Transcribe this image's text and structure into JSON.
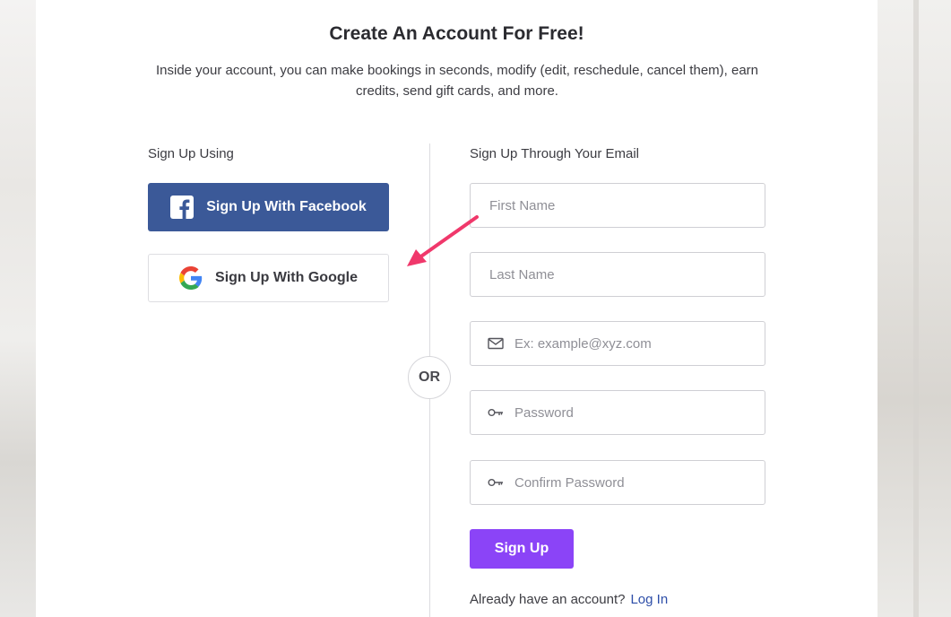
{
  "title": "Create An Account For Free!",
  "subtitle": "Inside your account, you can make bookings in seconds, modify (edit, reschedule, cancel them), earn credits, send gift cards, and more.",
  "social": {
    "heading": "Sign Up Using",
    "facebook_label": "Sign Up With Facebook",
    "google_label": "Sign Up With Google"
  },
  "divider_text": "OR",
  "email_form": {
    "heading": "Sign Up Through Your Email",
    "first_name_placeholder": "First Name",
    "last_name_placeholder": "Last Name",
    "email_placeholder": "Ex: example@xyz.com",
    "password_placeholder": "Password",
    "confirm_password_placeholder": "Confirm Password",
    "submit_label": "Sign Up"
  },
  "login_prompt": {
    "text": "Already have an account?",
    "link_label": "Log In"
  },
  "colors": {
    "facebook": "#3b5998",
    "accent_purple": "#8b44f7",
    "link_blue": "#2d4ea8",
    "annotation_arrow": "#f0386b"
  },
  "icons": {
    "facebook": "facebook-icon",
    "google": "google-icon",
    "email": "mail-icon",
    "password": "key-icon",
    "annotation": "arrow-annotation"
  }
}
